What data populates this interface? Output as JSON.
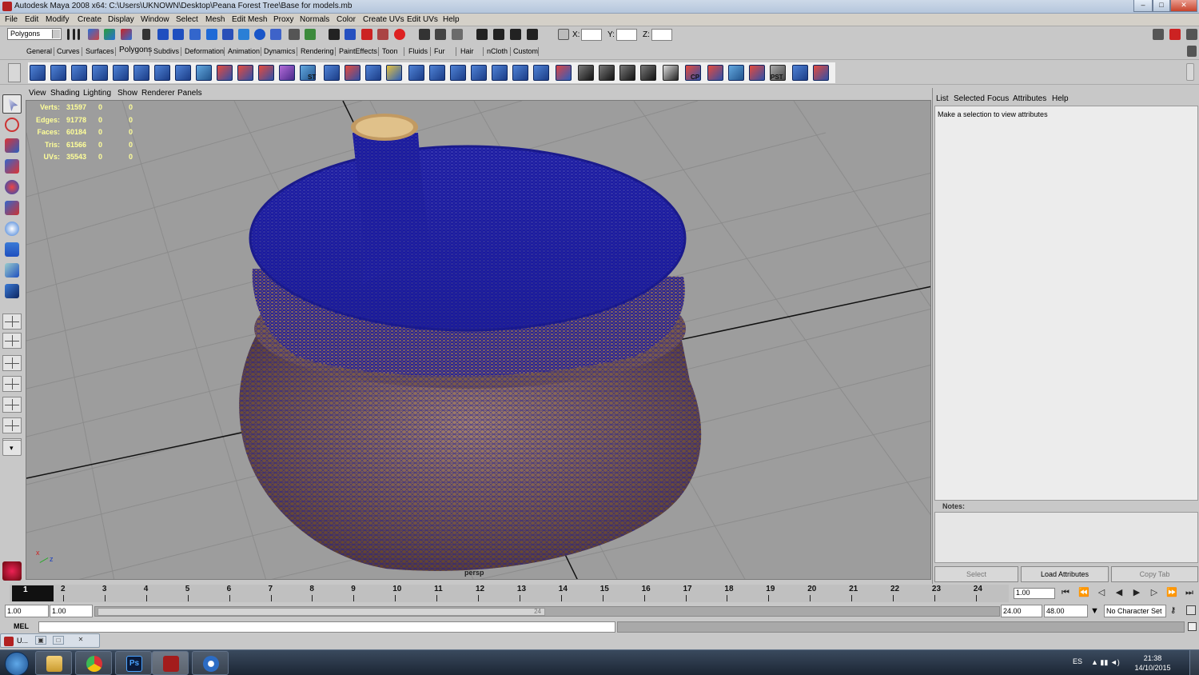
{
  "window": {
    "title": "Autodesk Maya 2008 x64: C:\\Users\\UKNOWN\\Desktop\\Peana Forest Tree\\Base for models.mb",
    "minimize": "–",
    "maximize": "□",
    "close": "✕"
  },
  "menubar": [
    "File",
    "Edit",
    "Modify",
    "Create",
    "Display",
    "Window",
    "Select",
    "Mesh",
    "Edit Mesh",
    "Proxy",
    "Normals",
    "Color",
    "Create UVs",
    "Edit UVs",
    "Help"
  ],
  "statusline": {
    "menuset": "Polygons",
    "x_label": "X:",
    "y_label": "Y:",
    "z_label": "Z:"
  },
  "shelf_tabs": [
    "General",
    "Curves",
    "Surfaces",
    "Polygons",
    "Subdivs",
    "Deformation",
    "Animation",
    "Dynamics",
    "Rendering",
    "PaintEffects",
    "Toon",
    "Fluids",
    "Fur",
    "Hair",
    "nCloth",
    "Custom"
  ],
  "shelf_tab_selected": "Polygons",
  "shelf_icon_labels": {
    "st": "ST",
    "cp": "CP",
    "pst": "PST"
  },
  "viewport": {
    "menu": [
      "View",
      "Shading",
      "Lighting",
      "Show",
      "Renderer",
      "Panels"
    ],
    "camera": "persp",
    "hud": [
      {
        "label": "Verts:",
        "v1": "31597",
        "v2": "0",
        "v3": "0"
      },
      {
        "label": "Edges:",
        "v1": "91778",
        "v2": "0",
        "v3": "0"
      },
      {
        "label": "Faces:",
        "v1": "60184",
        "v2": "0",
        "v3": "0"
      },
      {
        "label": "Tris:",
        "v1": "61566",
        "v2": "0",
        "v3": "0"
      },
      {
        "label": "UVs:",
        "v1": "35543",
        "v2": "0",
        "v3": "0"
      }
    ],
    "axis_x": "x",
    "axis_z": "z",
    "colors": {
      "background": "#9d9d9d",
      "grid": "#8a8a8a",
      "wireframe": "#1a1aa0",
      "wood": "#8a6a58"
    }
  },
  "attribute_editor": {
    "menu": [
      "List",
      "Selected",
      "Focus",
      "Attributes",
      "Help"
    ],
    "message": "Make a selection to view attributes",
    "notes_label": "Notes:",
    "buttons": {
      "select": "Select",
      "load": "Load Attributes",
      "copy": "Copy Tab"
    }
  },
  "timeline": {
    "current_frame": "1",
    "numbers": [
      "1",
      "2",
      "3",
      "4",
      "5",
      "6",
      "7",
      "8",
      "9",
      "10",
      "11",
      "12",
      "13",
      "14",
      "15",
      "16",
      "17",
      "18",
      "19",
      "20",
      "21",
      "22",
      "23",
      "24"
    ],
    "current_time_field": "1.00"
  },
  "range": {
    "start": "1.00",
    "inner_start": "1.00",
    "inner_end": "24",
    "end": "24.00",
    "anim_end": "48.00",
    "character_set": "No Character Set"
  },
  "command_line": {
    "mel_label": "MEL"
  },
  "minimized_window": {
    "label": "U..."
  },
  "taskbar": {
    "lang": "ES",
    "time": "21:38",
    "date": "14/10/2015"
  }
}
